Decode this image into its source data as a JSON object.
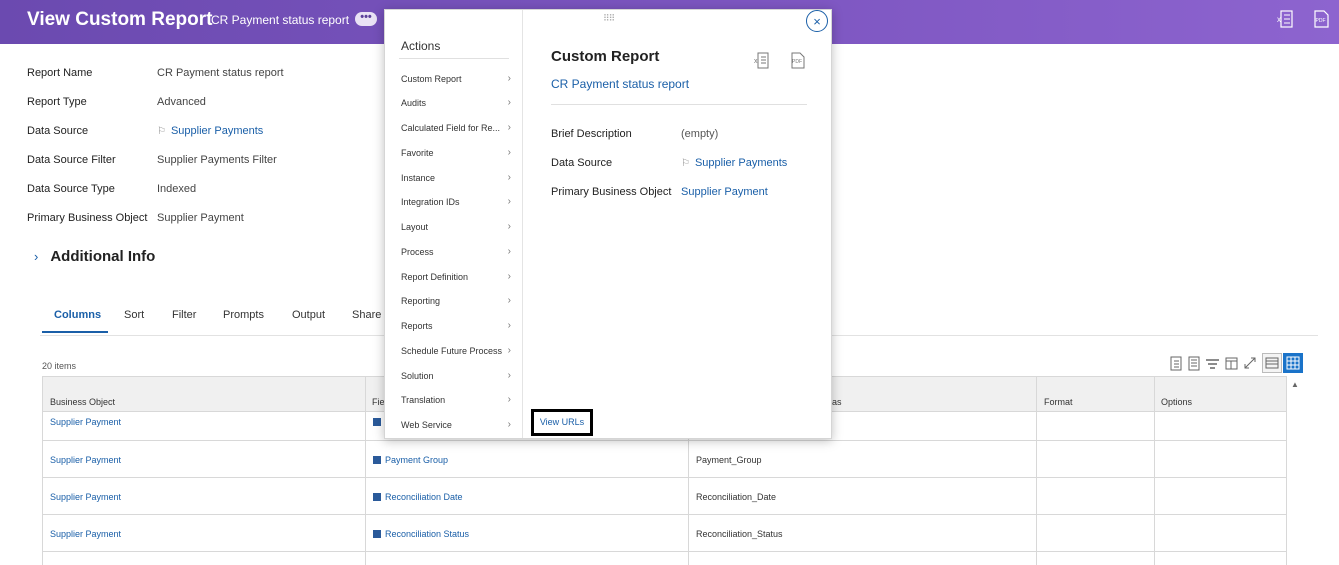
{
  "header": {
    "title": "View Custom Report",
    "subtitle": "CR Payment status report",
    "more_glyph": "•••",
    "excel_icon": "excel-export-icon",
    "pdf_icon": "pdf-export-icon"
  },
  "details": [
    {
      "label": "Report Name",
      "value": "CR Payment status report",
      "link": false
    },
    {
      "label": "Report Type",
      "value": "Advanced",
      "link": false
    },
    {
      "label": "Data Source",
      "value": "Supplier Payments",
      "link": true
    },
    {
      "label": "Data Source Filter",
      "value": "Supplier Payments Filter",
      "link": true
    },
    {
      "label": "Data Source Type",
      "value": "Indexed",
      "link": false
    },
    {
      "label": "Primary Business Object",
      "value": "Supplier Payment",
      "link": true
    }
  ],
  "additional_info": "Additional Info",
  "tabs": [
    "Columns",
    "Sort",
    "Filter",
    "Prompts",
    "Output",
    "Share"
  ],
  "item_count": "20 items",
  "table": {
    "headers": [
      "Business Object",
      "Fie",
      "as",
      "Format",
      "Options"
    ],
    "rows": [
      [
        "Supplier Payment",
        "",
        "",
        "",
        ""
      ],
      [
        "Supplier Payment",
        "Payment Group",
        "Payment_Group",
        "",
        ""
      ],
      [
        "Supplier Payment",
        "Reconciliation Date",
        "Reconciliation_Date",
        "",
        ""
      ],
      [
        "Supplier Payment",
        "Reconciliation Status",
        "Reconciliation_Status",
        "",
        ""
      ]
    ]
  },
  "popup": {
    "actions_title": "Actions",
    "menu": [
      "Custom Report",
      "Audits",
      "Calculated Field for Re...",
      "Favorite",
      "Instance",
      "Integration IDs",
      "Layout",
      "Process",
      "Report Definition",
      "Reporting",
      "Reports",
      "Schedule Future Process",
      "Solution",
      "Translation",
      "Web Service"
    ],
    "title": "Custom Report",
    "subtitle": "CR Payment status report",
    "fields": [
      {
        "label": "Brief Description",
        "value": "(empty)",
        "link": false
      },
      {
        "label": "Data Source",
        "value": "Supplier Payments",
        "link": true
      },
      {
        "label": "Primary Business Object",
        "value": "Supplier Payment",
        "link": true
      }
    ],
    "view_urls": "View URLs",
    "close_glyph": "×"
  },
  "colors": {
    "header": "#7e57c2",
    "link": "#1a5fa8",
    "highlight_border": "#000000"
  }
}
